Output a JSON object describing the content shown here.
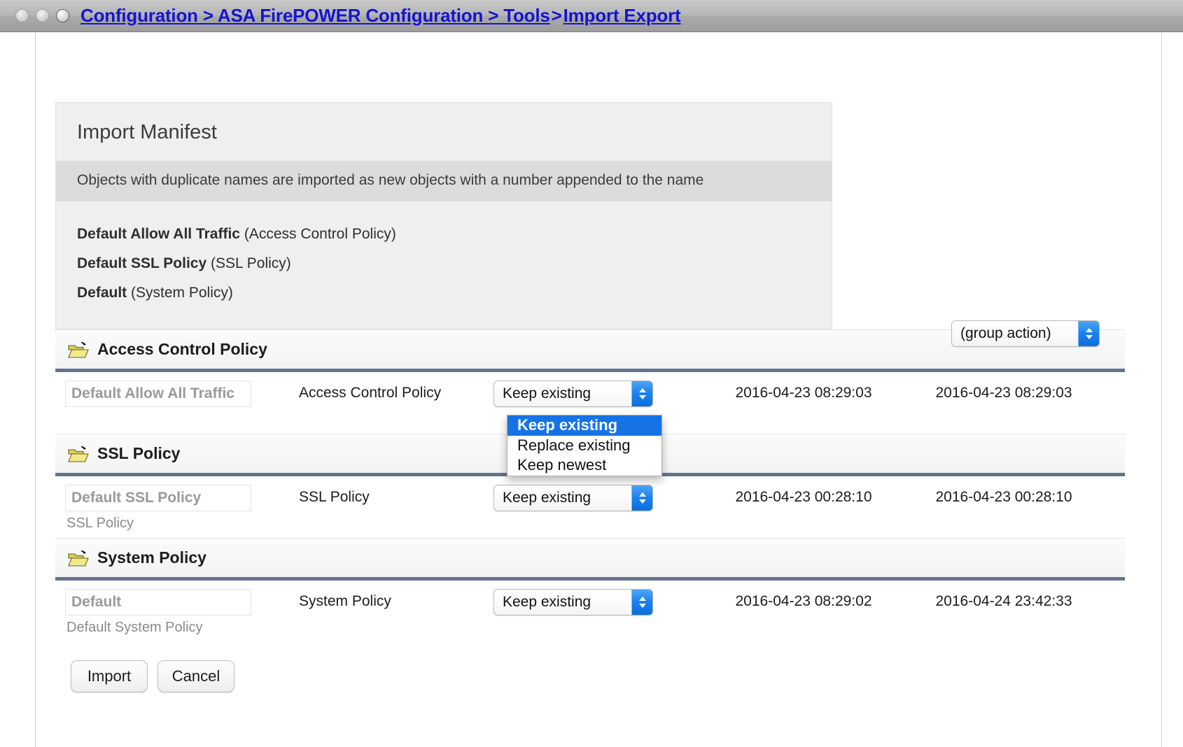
{
  "window": {
    "breadcrumb_parts": [
      "Configuration",
      "ASA FirePOWER Configuration",
      "Tools",
      "Import Export"
    ],
    "breadcrumb_full": "Configuration > ASA FirePOWER Configuration > Tools > Import Export",
    "crumb1": "Configuration > ASA FirePOWER Configuration > Tools",
    "crumb_sep": ">",
    "crumb2": "Import Export",
    "link_color": "#1414d2"
  },
  "manifest": {
    "title": "Import Manifest",
    "note": "Objects with duplicate names are imported as new objects with a number appended to the name",
    "items": [
      {
        "name": "Default Allow All Traffic",
        "type": "(Access Control Policy)"
      },
      {
        "name": "Default SSL Policy",
        "type": "(SSL Policy)"
      },
      {
        "name": "Default",
        "type": "(System Policy)"
      }
    ]
  },
  "group_action": {
    "label": "(group action)",
    "options": [
      "(group action)",
      "Keep existing",
      "Replace existing",
      "Keep newest"
    ]
  },
  "sections": [
    {
      "icon": "open-folder-icon",
      "label": "Access Control Policy",
      "rows": [
        {
          "name": "Default Allow All Traffic",
          "subtitle": "",
          "type": "Access Control Policy",
          "action": "Keep existing",
          "date_left": "2016-04-23 08:29:03",
          "date_right": "2016-04-23 08:29:03",
          "dropdown_open": true
        }
      ]
    },
    {
      "icon": "open-folder-icon",
      "label": "SSL Policy",
      "rows": [
        {
          "name": "Default SSL Policy",
          "subtitle": "SSL Policy",
          "type": "SSL Policy",
          "action": "Keep existing",
          "date_left": "2016-04-23 00:28:10",
          "date_right": "2016-04-23 00:28:10",
          "dropdown_open": false
        }
      ]
    },
    {
      "icon": "open-folder-icon",
      "label": "System Policy",
      "rows": [
        {
          "name": "Default",
          "subtitle": "Default System Policy",
          "type": "System Policy",
          "action": "Keep existing",
          "date_left": "2016-04-23 08:29:02",
          "date_right": "2016-04-24 23:42:33",
          "dropdown_open": false
        }
      ]
    }
  ],
  "dropdown_popup": {
    "options": [
      "Keep existing",
      "Replace existing",
      "Keep newest"
    ],
    "selected_index": 0,
    "highlight_color": "#1573e6"
  },
  "action_options": [
    "Keep existing",
    "Replace existing",
    "Keep newest"
  ],
  "footer": {
    "import_label": "Import",
    "cancel_label": "Cancel"
  }
}
